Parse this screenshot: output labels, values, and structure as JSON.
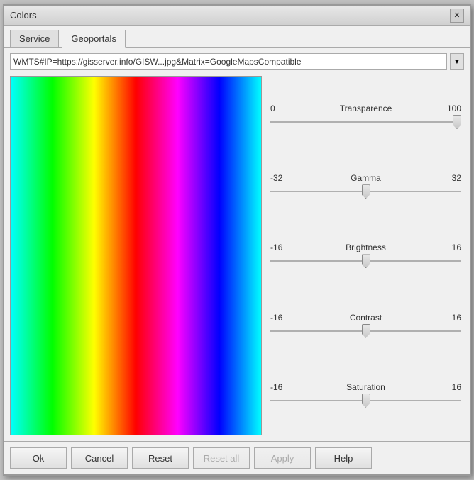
{
  "dialog": {
    "title": "Colors"
  },
  "tabs": [
    {
      "id": "service",
      "label": "Service",
      "active": false
    },
    {
      "id": "geoportals",
      "label": "Geoportals",
      "active": true
    }
  ],
  "url": {
    "value": "WMTS#IP=https://gisserver.info/GISW...jpg&Matrix=GoogleMapsCompatible",
    "placeholder": ""
  },
  "sliders": [
    {
      "id": "transparence",
      "label": "Transparence",
      "min": 0,
      "max": 100,
      "value": 100,
      "min_label": "0",
      "max_label": "100"
    },
    {
      "id": "gamma",
      "label": "Gamma",
      "min": -32,
      "max": 32,
      "value": 0,
      "min_label": "-32",
      "max_label": "32"
    },
    {
      "id": "brightness",
      "label": "Brightness",
      "min": -16,
      "max": 16,
      "value": 0,
      "min_label": "-16",
      "max_label": "16"
    },
    {
      "id": "contrast",
      "label": "Contrast",
      "min": -16,
      "max": 16,
      "value": 0,
      "min_label": "-16",
      "max_label": "16"
    },
    {
      "id": "saturation",
      "label": "Saturation",
      "min": -16,
      "max": 16,
      "value": 0,
      "min_label": "-16",
      "max_label": "16"
    }
  ],
  "buttons": {
    "ok": "Ok",
    "cancel": "Cancel",
    "reset": "Reset",
    "reset_all": "Reset all",
    "apply": "Apply",
    "help": "Help"
  },
  "icons": {
    "close": "✕",
    "dropdown": "▼"
  }
}
